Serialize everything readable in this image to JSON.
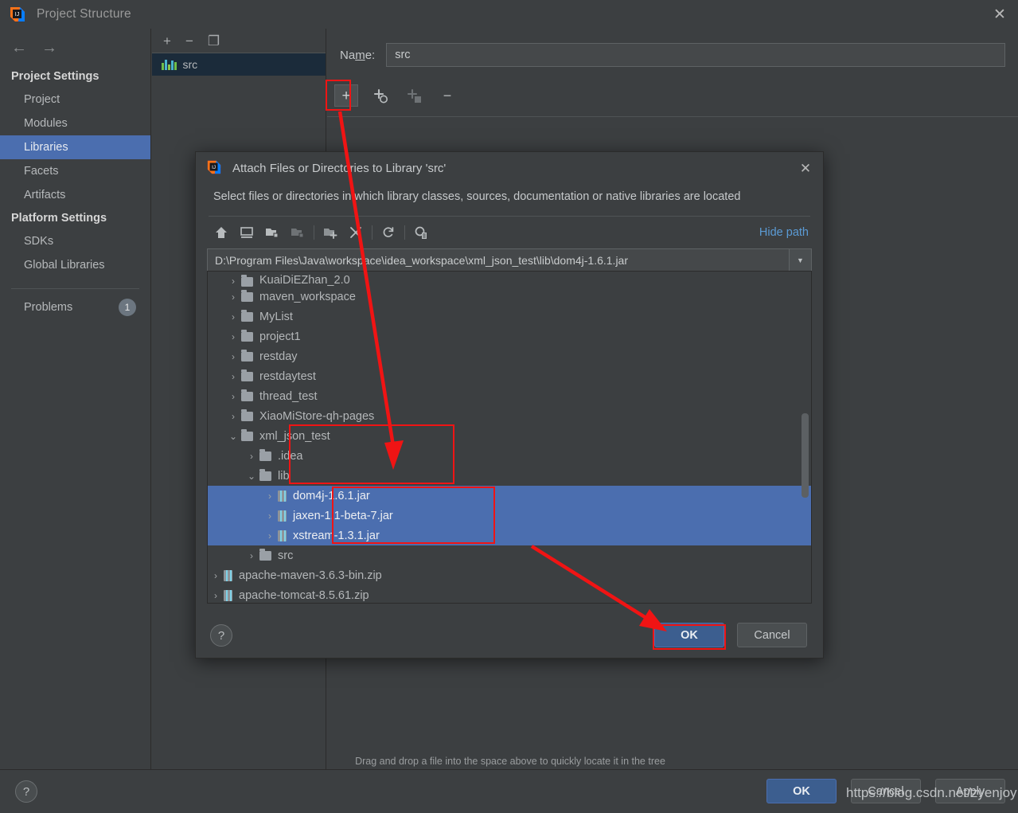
{
  "window": {
    "title": "Project Structure",
    "close_label": "✕",
    "logo_name": "intellij-idea-logo"
  },
  "sidebar": {
    "back_arrow": "←",
    "forward_arrow": "→",
    "groups": [
      {
        "label": "Project Settings",
        "items": [
          {
            "label": "Project",
            "selected": false
          },
          {
            "label": "Modules",
            "selected": false
          },
          {
            "label": "Libraries",
            "selected": true
          },
          {
            "label": "Facets",
            "selected": false
          },
          {
            "label": "Artifacts",
            "selected": false
          }
        ]
      },
      {
        "label": "Platform Settings",
        "items": [
          {
            "label": "SDKs",
            "selected": false
          },
          {
            "label": "Global Libraries",
            "selected": false
          }
        ]
      }
    ],
    "problems": {
      "label": "Problems",
      "count": "1"
    }
  },
  "mid_panel": {
    "toolbar": [
      {
        "name": "add-library-button",
        "glyph": "+"
      },
      {
        "name": "remove-library-button",
        "glyph": "−"
      },
      {
        "name": "copy-library-button",
        "glyph": "❐"
      }
    ],
    "items": [
      {
        "label": "src",
        "selected": true
      }
    ]
  },
  "right_panel": {
    "name_label_pre": "Na",
    "name_label_accel": "m",
    "name_label_post": "e:",
    "name_value": "src",
    "name_placeholder": "Library name",
    "toolbar": [
      {
        "name": "add-entry-button",
        "glyph": "+",
        "state": "highlighted"
      },
      {
        "name": "add-source-button",
        "glyph": "+",
        "state": "enabled"
      },
      {
        "name": "add-javadoc-button",
        "glyph": "+",
        "state": "disabled"
      },
      {
        "name": "remove-entry-button",
        "glyph": "−",
        "state": "enabled"
      }
    ]
  },
  "main_footer": {
    "ok": "OK",
    "cancel": "Cancel",
    "apply": "Apply",
    "help": "?"
  },
  "dialog": {
    "title": "Attach Files or Directories to Library 'src'",
    "close_label": "✕",
    "subtitle": "Select files or directories in which library classes, sources, documentation or native libraries are located",
    "toolbar": [
      {
        "name": "home-icon",
        "enabled": true
      },
      {
        "name": "desktop-icon",
        "enabled": true
      },
      {
        "name": "project-folder-icon",
        "enabled": true
      },
      {
        "name": "module-folder-icon",
        "enabled": false
      },
      {
        "name": "new-folder-icon",
        "enabled": true
      },
      {
        "name": "delete-icon",
        "enabled": true
      },
      {
        "name": "refresh-icon",
        "enabled": true
      },
      {
        "name": "show-hidden-files-icon",
        "enabled": true
      }
    ],
    "hide_path_label": "Hide path",
    "path_value": "D:\\Program Files\\Java\\workspace\\idea_workspace\\xml_json_test\\lib\\dom4j-1.6.1.jar",
    "path_placeholder": "Path",
    "tree": [
      {
        "label": "KuaiDiEZhan_2.0",
        "indent": 0,
        "twist": "›",
        "icon": "folder",
        "selected": false,
        "clipped": true
      },
      {
        "label": "maven_workspace",
        "indent": 0,
        "twist": "›",
        "icon": "folder",
        "selected": false
      },
      {
        "label": "MyList",
        "indent": 0,
        "twist": "›",
        "icon": "folder",
        "selected": false
      },
      {
        "label": "project1",
        "indent": 0,
        "twist": "›",
        "icon": "folder",
        "selected": false
      },
      {
        "label": "restday",
        "indent": 0,
        "twist": "›",
        "icon": "folder",
        "selected": false
      },
      {
        "label": "restdaytest",
        "indent": 0,
        "twist": "›",
        "icon": "folder",
        "selected": false
      },
      {
        "label": "thread_test",
        "indent": 0,
        "twist": "›",
        "icon": "folder",
        "selected": false
      },
      {
        "label": "XiaoMiStore-qh-pages",
        "indent": 0,
        "twist": "›",
        "icon": "folder",
        "selected": false
      },
      {
        "label": "xml_json_test",
        "indent": 0,
        "twist": "⌄",
        "icon": "folder",
        "selected": false
      },
      {
        "label": ".idea",
        "indent": 1,
        "twist": "›",
        "icon": "folder",
        "selected": false
      },
      {
        "label": "lib",
        "indent": 1,
        "twist": "⌄",
        "icon": "folder",
        "selected": false
      },
      {
        "label": "dom4j-1.6.1.jar",
        "indent": 2,
        "twist": "›",
        "icon": "jar",
        "selected": true
      },
      {
        "label": "jaxen-1.1-beta-7.jar",
        "indent": 2,
        "twist": "›",
        "icon": "jar",
        "selected": true
      },
      {
        "label": "xstream-1.3.1.jar",
        "indent": 2,
        "twist": "›",
        "icon": "jar",
        "selected": true
      },
      {
        "label": "src",
        "indent": 1,
        "twist": "›",
        "icon": "folder",
        "selected": false
      },
      {
        "label": "apache-maven-3.6.3-bin.zip",
        "indent": -1,
        "twist": "›",
        "icon": "jar",
        "selected": false
      },
      {
        "label": "apache-tomcat-8.5.61.zip",
        "indent": -1,
        "twist": "›",
        "icon": "jar",
        "selected": false
      }
    ],
    "hint": "Drag and drop a file into the space above to quickly locate it in the tree",
    "ok": "OK",
    "cancel": "Cancel",
    "help": "?"
  },
  "annotations": {
    "watermark": "https://blog.csdn.net/zyenjoy",
    "accent_red": "#f01414"
  }
}
